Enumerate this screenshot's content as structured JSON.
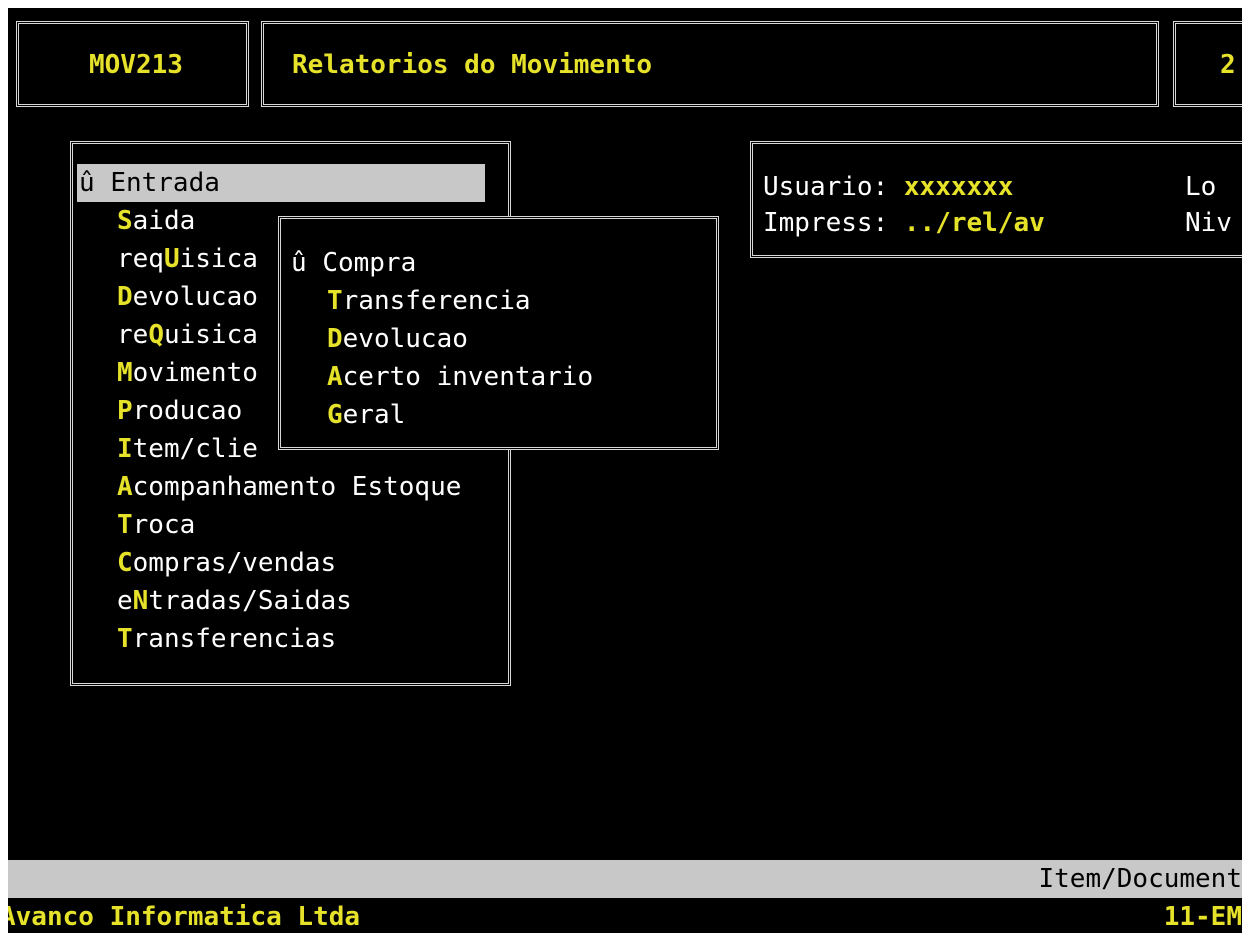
{
  "header": {
    "program_code": "MOV213",
    "title": "Relatorios do Movimento",
    "right_fragment": "2"
  },
  "main_menu": {
    "items": [
      {
        "prefix": "û ",
        "hot": "",
        "rest": "Entrada",
        "selected": true
      },
      {
        "prefix": "",
        "hot": "S",
        "rest": "aida"
      },
      {
        "prefix": "req",
        "hot": "U",
        "rest": "isica"
      },
      {
        "prefix": "",
        "hot": "D",
        "rest": "evolucao"
      },
      {
        "prefix": "re",
        "hot": "Q",
        "rest": "uisica"
      },
      {
        "prefix": "",
        "hot": "M",
        "rest": "ovimento"
      },
      {
        "prefix": "",
        "hot": "P",
        "rest": "roducao"
      },
      {
        "prefix": "",
        "hot": "I",
        "rest": "tem/clie"
      },
      {
        "prefix": "",
        "hot": "A",
        "rest": "companhamento Estoque"
      },
      {
        "prefix": "",
        "hot": "T",
        "rest": "roca"
      },
      {
        "prefix": "",
        "hot": "C",
        "rest": "ompras/vendas"
      },
      {
        "prefix": "e",
        "hot": "N",
        "rest": "tradas/Saidas"
      },
      {
        "prefix": "",
        "hot": "T",
        "rest": "ransferencias"
      }
    ]
  },
  "sub_menu": {
    "items": [
      {
        "prefix": "û ",
        "hot": "",
        "rest": "Compra",
        "selected": true
      },
      {
        "prefix": "",
        "hot": "T",
        "rest": "ransferencia"
      },
      {
        "prefix": "",
        "hot": "D",
        "rest": "evolucao"
      },
      {
        "prefix": "",
        "hot": "A",
        "rest": "certo inventario"
      },
      {
        "prefix": "",
        "hot": "G",
        "rest": "eral"
      }
    ]
  },
  "info": {
    "usuario_label": "Usuario: ",
    "usuario_value": "xxxxxxx",
    "impress_label": "Impress: ",
    "impress_value": "../rel/av",
    "right_label_1": "Lo",
    "right_label_2": "Niv"
  },
  "status_bar": {
    "text": "Item/Document"
  },
  "footer": {
    "company": "Avanco Informatica Ltda",
    "right_text": "11-EM"
  },
  "colors": {
    "background": "#000000",
    "accent": "#e6e22a",
    "highlight_bar": "#c8c8c8",
    "text": "#ffffff"
  }
}
